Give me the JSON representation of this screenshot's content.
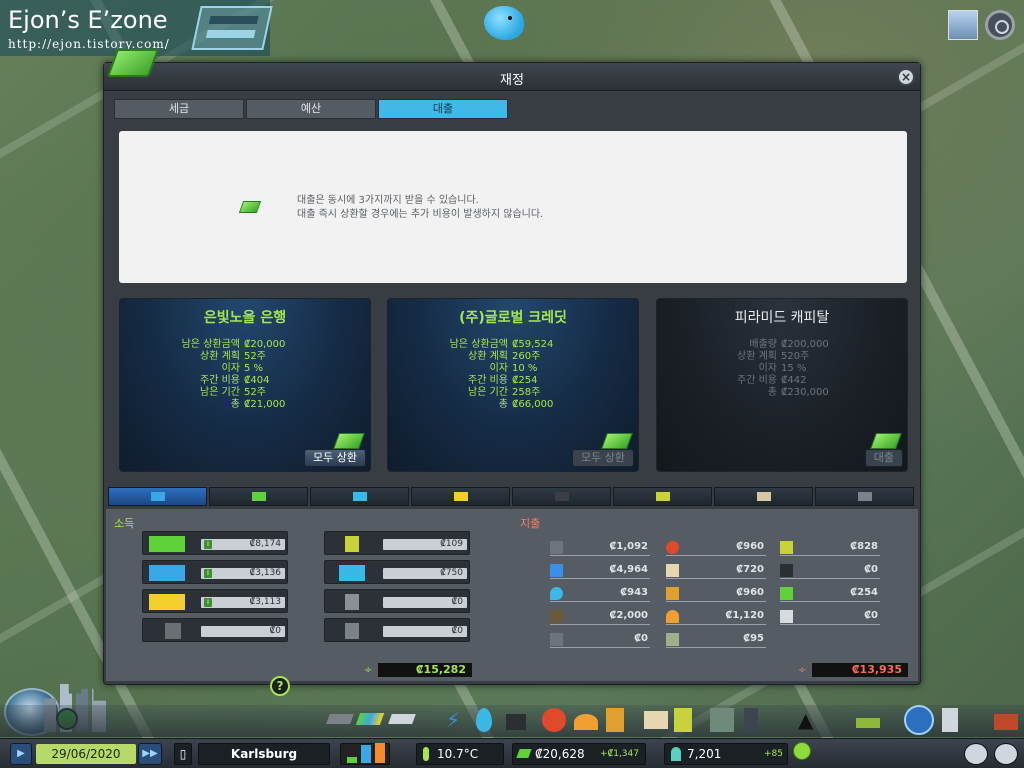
{
  "watermark": {
    "title": "Ejon’s E’zone",
    "url": "http://ejon.tistory.com/"
  },
  "panel": {
    "title": "재정",
    "close": "×",
    "tabs": [
      {
        "label": "세금",
        "active": false
      },
      {
        "label": "예산",
        "active": false
      },
      {
        "label": "대출",
        "active": true
      }
    ],
    "info": {
      "line1": "대출은 동시에 3가지까지 받을 수 있습니다.",
      "line2": "대출 즉시 상환할 경우에는 추가 비용이 발생하지 않습니다."
    }
  },
  "lenders": [
    {
      "name": "은빛노을 은행",
      "rows": [
        {
          "k": "남은 상환금액",
          "v": "₡20,000"
        },
        {
          "k": "상환 계획",
          "v": "52주"
        },
        {
          "k": "이자",
          "v": "5 %"
        },
        {
          "k": "주간 비용",
          "v": "₡404"
        },
        {
          "k": "남은 기간",
          "v": "52주"
        },
        {
          "k": "총",
          "v": "₡21,000"
        }
      ],
      "button": "모두 상환",
      "enabled": true
    },
    {
      "name": "(주)글로벌 크레딧",
      "rows": [
        {
          "k": "남은 상환금액",
          "v": "₡59,524"
        },
        {
          "k": "상환 계획",
          "v": "260주"
        },
        {
          "k": "이자",
          "v": "10 %"
        },
        {
          "k": "주간 비용",
          "v": "₡254"
        },
        {
          "k": "남은 기간",
          "v": "258주"
        },
        {
          "k": "총",
          "v": "₡66,000"
        }
      ],
      "button": "모두 상환",
      "enabled": false
    },
    {
      "name": "피라미드 캐피탈",
      "rows": [
        {
          "k": "배출량",
          "v": "₡200,000"
        },
        {
          "k": "상환 계획",
          "v": "520주"
        },
        {
          "k": "이자",
          "v": "15 %"
        },
        {
          "k": "주간 비용",
          "v": "₡442"
        },
        {
          "k": "총",
          "v": "₡230,000"
        }
      ],
      "button": "대출",
      "enabled": false
    }
  ],
  "category_tabs": [
    "residential-icon",
    "commercial-icon",
    "industrial-icon",
    "office-icon",
    "factory-icon",
    "transport-icon",
    "tourism-icon",
    "road-icon"
  ],
  "income": {
    "label": "소득",
    "rows_left": [
      {
        "icon": "residential-icon",
        "value": "₡8,174",
        "color": "#5fd23a"
      },
      {
        "icon": "commercial-icon",
        "value": "₡3,136",
        "color": "#3aa8e6"
      },
      {
        "icon": "industrial-icon",
        "value": "₡3,113",
        "color": "#f2cf2a"
      },
      {
        "icon": "office-icon",
        "value": "₡0",
        "color": "#6b6f73"
      }
    ],
    "rows_right": [
      {
        "icon": "bus-icon",
        "value": "₡109",
        "color": "#c9d23a"
      },
      {
        "icon": "water-icon",
        "value": "₡750",
        "color": "#3ab8e6"
      },
      {
        "icon": "monument-icon",
        "value": "₡0",
        "color": "#8a9096"
      },
      {
        "icon": "road-icon",
        "value": "₡0",
        "color": "#7b8389"
      }
    ],
    "total_symbol": "÷",
    "total": "₡15,282"
  },
  "expenses": {
    "label": "지출",
    "col1": [
      {
        "icon": "road-icon",
        "value": "₡1,092"
      },
      {
        "icon": "electricity-icon",
        "value": "₡4,964"
      },
      {
        "icon": "water-drop-icon",
        "value": "₡943"
      },
      {
        "icon": "garbage-icon",
        "value": "₡2,000"
      },
      {
        "icon": "monument-icon",
        "value": "₡0"
      }
    ],
    "col2": [
      {
        "icon": "fire-icon",
        "value": "₡960"
      },
      {
        "icon": "education-icon",
        "value": "₡720"
      },
      {
        "icon": "police-icon",
        "value": "₡960"
      },
      {
        "icon": "health-icon",
        "value": "₡1,120"
      },
      {
        "icon": "park-icon",
        "value": "₡95"
      }
    ],
    "col3": [
      {
        "icon": "bus-icon",
        "value": "₡828"
      },
      {
        "icon": "factory-icon",
        "value": "₡0"
      },
      {
        "icon": "money-icon",
        "value": "₡254"
      },
      {
        "icon": "policy-icon",
        "value": "₡0"
      }
    ],
    "total_symbol": "÷",
    "total": "₡13,935"
  },
  "help": "?",
  "statusbar": {
    "play": "▶",
    "date": "29/06/2020",
    "ff": "▶▶",
    "city": "Karlsburg",
    "temperature": "10.7°C",
    "money": "₡20,628",
    "money_delta": "+₡1,347",
    "population": "7,201",
    "population_delta": "+85"
  }
}
